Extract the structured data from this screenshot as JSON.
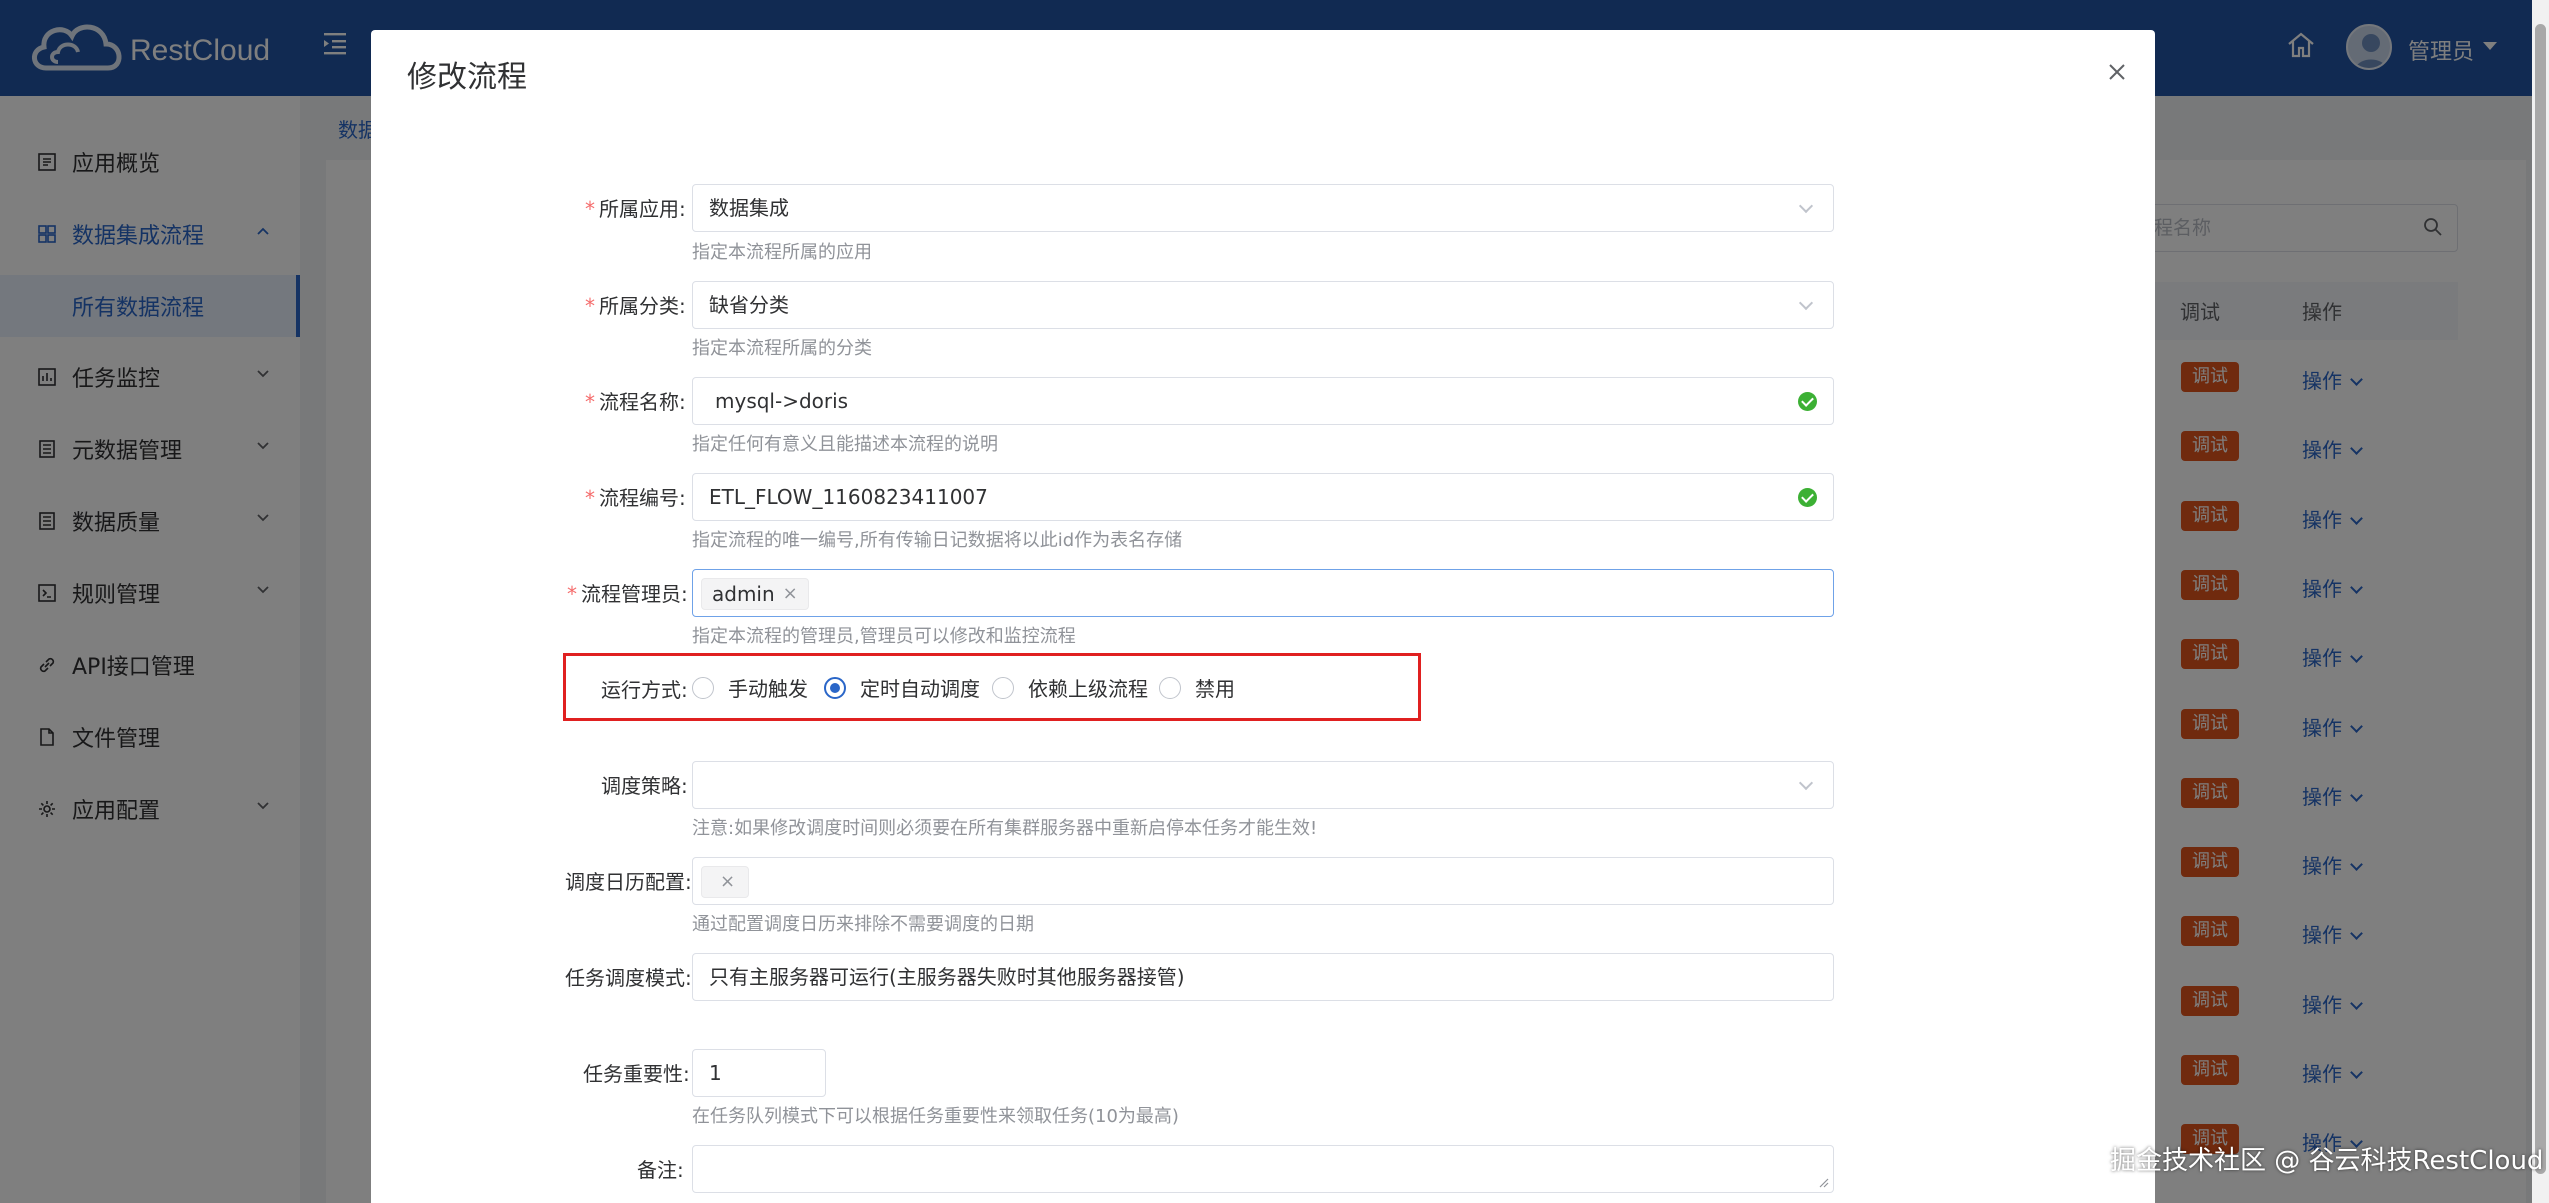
{
  "app": {
    "brand": "RestCloud"
  },
  "header": {
    "user_name": "管理员"
  },
  "sidebar": {
    "items": [
      {
        "label": "应用概览",
        "icon": "document-icon"
      },
      {
        "label": "数据集成流程",
        "icon": "grid-icon"
      },
      {
        "label": "任务监控",
        "icon": "monitor-icon"
      },
      {
        "label": "元数据管理",
        "icon": "list-icon"
      },
      {
        "label": "数据质量",
        "icon": "list-icon"
      },
      {
        "label": "规则管理",
        "icon": "terminal-icon"
      },
      {
        "label": "API接口管理",
        "icon": "link-icon"
      },
      {
        "label": "文件管理",
        "icon": "file-icon"
      },
      {
        "label": "应用配置",
        "icon": "gear-icon"
      }
    ],
    "sub_active": "所有数据流程"
  },
  "background": {
    "breadcrumb": "数据",
    "search_placeholder": "流程名称",
    "columns": {
      "debug": "调试",
      "ops": "操作"
    },
    "row_debug_label": "调试",
    "row_op_label": "操作",
    "row_count": 12
  },
  "dialog": {
    "title": "修改流程",
    "fields": {
      "app": {
        "label": "所属应用:",
        "value": "数据集成",
        "help": "指定本流程所属的应用"
      },
      "category": {
        "label": "所属分类:",
        "value": "缺省分类",
        "help": "指定本流程所属的分类"
      },
      "name": {
        "label": "流程名称:",
        "value": "mysql->doris",
        "help": "指定任何有意义且能描述本流程的说明"
      },
      "code": {
        "label": "流程编号:",
        "value": "ETL_FLOW_1160823411007",
        "help": "指定流程的唯一编号,所有传输日记数据将以此id作为表名存储"
      },
      "admin": {
        "label": "流程管理员:",
        "tag": "admin",
        "help": "指定本流程的管理员,管理员可以修改和监控流程"
      },
      "run_mode": {
        "label": "运行方式:",
        "options": [
          "手动触发",
          "定时自动调度",
          "依赖上级流程",
          "禁用"
        ],
        "selected": "定时自动调度"
      },
      "strategy": {
        "label": "调度策略:",
        "value": "",
        "help": "注意:如果修改调度时间则必须要在所有集群服务器中重新启停本任务才能生效!"
      },
      "calendar": {
        "label": "调度日历配置:",
        "help": "通过配置调度日历来排除不需要调度的日期"
      },
      "dispatch_mode": {
        "label": "任务调度模式:",
        "value": "只有主服务器可运行(主服务器失败时其他服务器接管)"
      },
      "importance": {
        "label": "任务重要性:",
        "value": "1",
        "help": "在任务队列模式下可以根据任务重要性来领取任务(10为最高)"
      },
      "remark": {
        "label": "备注:",
        "value": ""
      }
    }
  },
  "watermark": "掘金技术社区 @ 谷云科技RestCloud",
  "colors": {
    "primary": "#2255a4",
    "accent": "#2a66c8",
    "danger": "#e02020",
    "debug": "#e0541d",
    "success": "#3cb034"
  }
}
